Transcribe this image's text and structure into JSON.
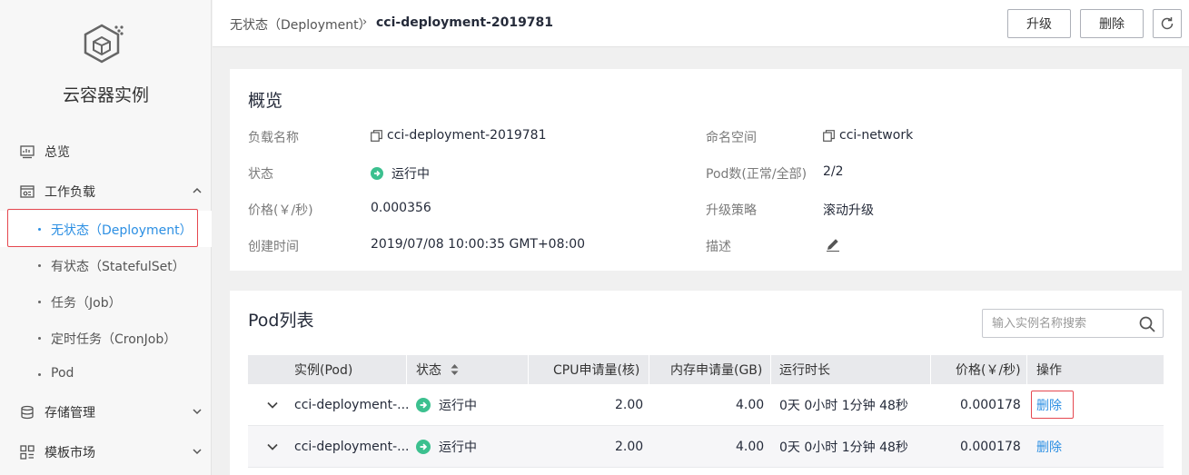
{
  "sidebar": {
    "title": "云容器实例",
    "items": [
      {
        "label": "总览"
      },
      {
        "label": "工作负载"
      },
      {
        "label": "存储管理"
      },
      {
        "label": "模板市场"
      }
    ],
    "sub_items": [
      {
        "label": "无状态（Deployment）"
      },
      {
        "label": "有状态（StatefulSet）"
      },
      {
        "label": "任务（Job）"
      },
      {
        "label": "定时任务（CronJob）"
      },
      {
        "label": "Pod"
      }
    ]
  },
  "header": {
    "breadcrumb_parent": "无状态（Deployment）",
    "breadcrumb_sep": "›",
    "breadcrumb_current": "cci-deployment-2019781",
    "upgrade_label": "升级",
    "delete_label": "删除"
  },
  "overview": {
    "title": "概览",
    "workload_name_label": "负载名称",
    "workload_name": "cci-deployment-2019781",
    "status_label": "状态",
    "status": "运行中",
    "price_label": "价格(￥/秒)",
    "price": "0.000356",
    "created_label": "创建时间",
    "created": "2019/07/08 10:00:35 GMT+08:00",
    "namespace_label": "命名空间",
    "namespace": "cci-network",
    "pods_label": "Pod数(正常/全部)",
    "pods": "2/2",
    "strategy_label": "升级策略",
    "strategy": "滚动升级",
    "desc_label": "描述"
  },
  "pods": {
    "title": "Pod列表",
    "search_placeholder": "输入实例名称搜索",
    "columns": [
      "实例(Pod)",
      "状态",
      "CPU申请量(核)",
      "内存申请量(GB)",
      "运行时长",
      "价格(￥/秒)",
      "操作"
    ],
    "rows": [
      {
        "name": "cci-deployment-...",
        "status": "运行中",
        "cpu": "2.00",
        "mem": "4.00",
        "uptime": "0天 0小时 1分钟 48秒",
        "price": "0.000178",
        "action": "删除"
      },
      {
        "name": "cci-deployment-...",
        "status": "运行中",
        "cpu": "2.00",
        "mem": "4.00",
        "uptime": "0天 0小时 1分钟 48秒",
        "price": "0.000178",
        "action": "删除"
      }
    ]
  },
  "colors": {
    "accent": "#2c8fe3",
    "running": "#3cc08f",
    "highlight": "#e5474f"
  }
}
